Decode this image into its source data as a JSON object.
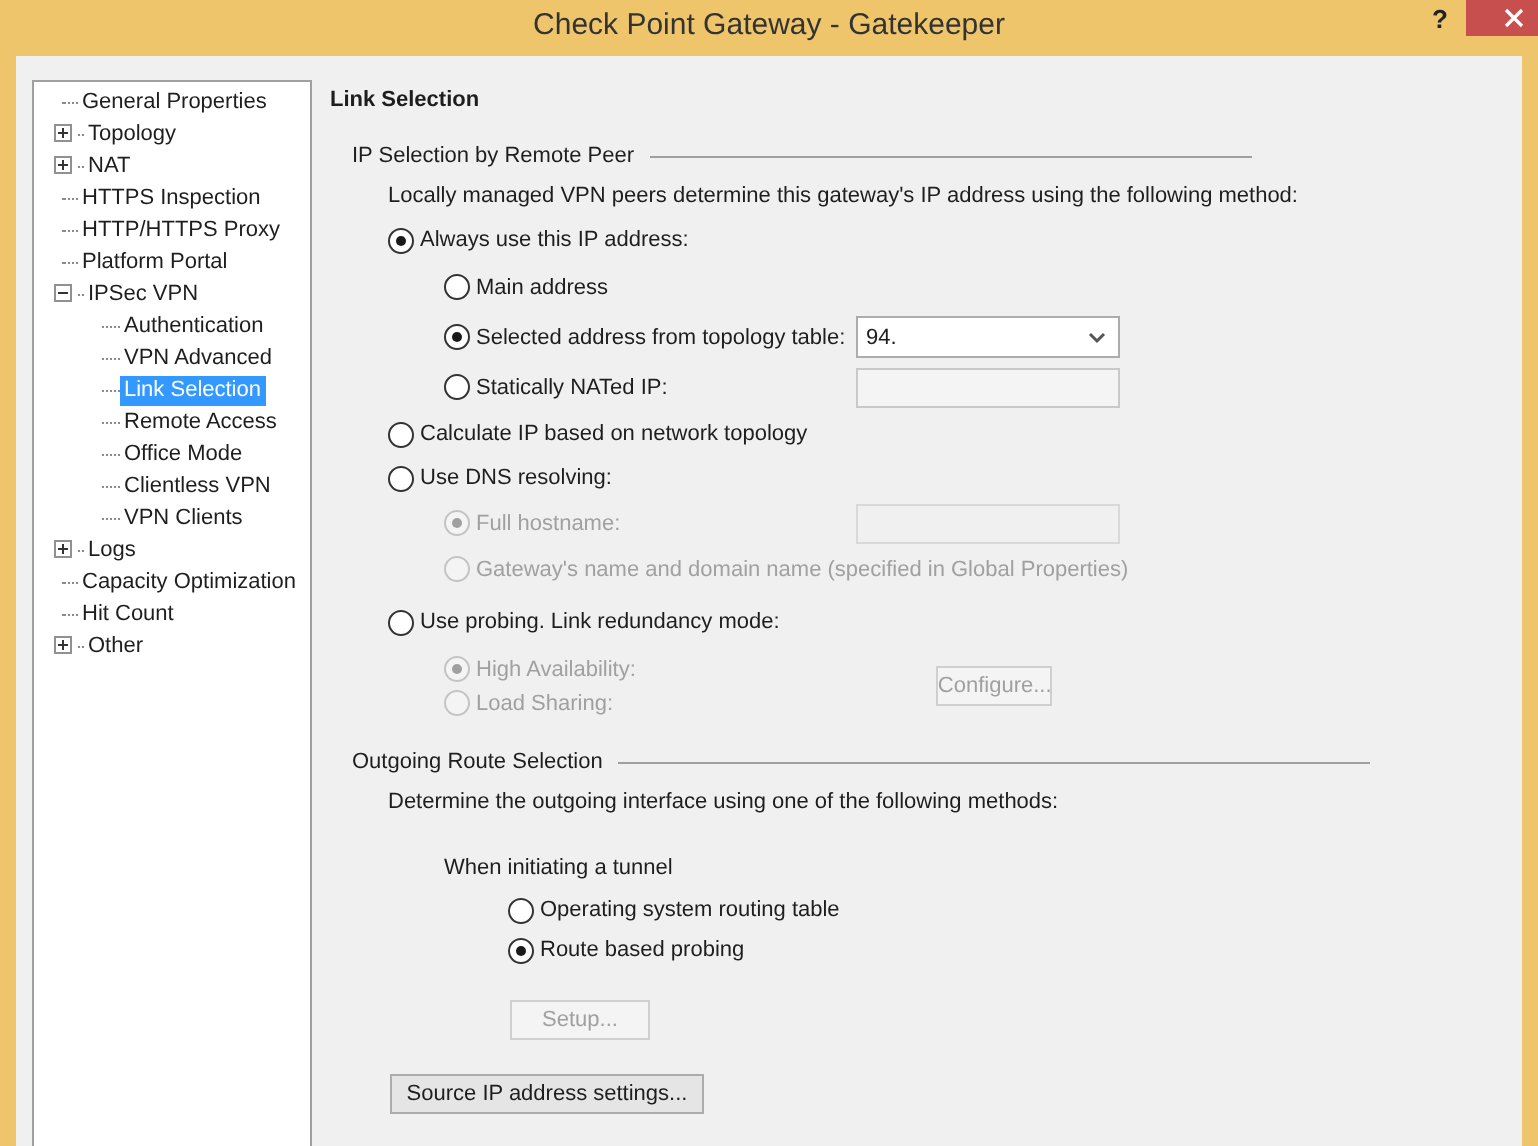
{
  "window": {
    "title": "Check Point Gateway - Gatekeeper",
    "help": "?"
  },
  "tree": [
    {
      "label": "General Properties",
      "selected": false
    },
    {
      "label": "Topology",
      "expanded": false,
      "selected": false
    },
    {
      "label": "NAT",
      "expanded": false,
      "selected": false
    },
    {
      "label": "HTTPS Inspection",
      "selected": false
    },
    {
      "label": "HTTP/HTTPS Proxy",
      "selected": false
    },
    {
      "label": "Platform Portal",
      "selected": false
    },
    {
      "label": "IPSec VPN",
      "expanded": true,
      "selected": false,
      "children": [
        {
          "label": "Authentication",
          "selected": false
        },
        {
          "label": "VPN Advanced",
          "selected": false
        },
        {
          "label": "Link Selection",
          "selected": true
        },
        {
          "label": "Remote Access",
          "selected": false
        },
        {
          "label": "Office Mode",
          "selected": false
        },
        {
          "label": "Clientless VPN",
          "selected": false
        },
        {
          "label": "VPN Clients",
          "selected": false
        }
      ]
    },
    {
      "label": "Logs",
      "expanded": false,
      "selected": false
    },
    {
      "label": "Capacity Optimization",
      "selected": false
    },
    {
      "label": "Hit Count",
      "selected": false
    },
    {
      "label": "Other",
      "expanded": false,
      "selected": false
    }
  ],
  "page_title": "Link Selection",
  "ip_selection": {
    "heading": "IP Selection by Remote Peer",
    "description": "Locally managed VPN peers determine this gateway's IP address using the following method:",
    "options": [
      {
        "label": "Always use this IP address:",
        "selected": true,
        "children": [
          {
            "label": "Main address",
            "selected": false,
            "disabled": false
          },
          {
            "label": "Selected address from topology table:",
            "selected": true,
            "disabled": false,
            "control": {
              "kind": "dropdown",
              "value": "94."
            }
          },
          {
            "label": "Statically NATed IP:",
            "selected": false,
            "disabled": false,
            "control": {
              "kind": "field"
            }
          }
        ]
      },
      {
        "label": "Calculate IP based on network topology",
        "selected": false
      },
      {
        "label": "Use DNS resolving:",
        "selected": false,
        "children": [
          {
            "label": "Full hostname:",
            "selected": true,
            "disabled": true,
            "control": {
              "kind": "field"
            }
          },
          {
            "label": "Gateway's name and domain name (specified in Global Properties)",
            "selected": false,
            "disabled": true
          }
        ]
      },
      {
        "label": "Use probing. Link redundancy mode:",
        "selected": false,
        "button": {
          "label": "Configure...",
          "disabled": true
        },
        "children": [
          {
            "label": "High Availability:",
            "selected": true,
            "disabled": true
          },
          {
            "label": "Load Sharing:",
            "selected": false,
            "disabled": true
          }
        ]
      }
    ]
  },
  "outgoing": {
    "heading": "Outgoing Route Selection",
    "description": "Determine the outgoing interface using one of the following methods:",
    "tunnel_label": "When initiating a tunnel",
    "options": [
      {
        "label": "Operating system routing table",
        "selected": false,
        "disabled": false
      },
      {
        "label": "Route based probing",
        "selected": true,
        "disabled": false
      }
    ],
    "setup_button": {
      "label": "Setup...",
      "disabled": true
    },
    "source_button": {
      "label": "Source IP address settings...",
      "disabled": false
    }
  }
}
